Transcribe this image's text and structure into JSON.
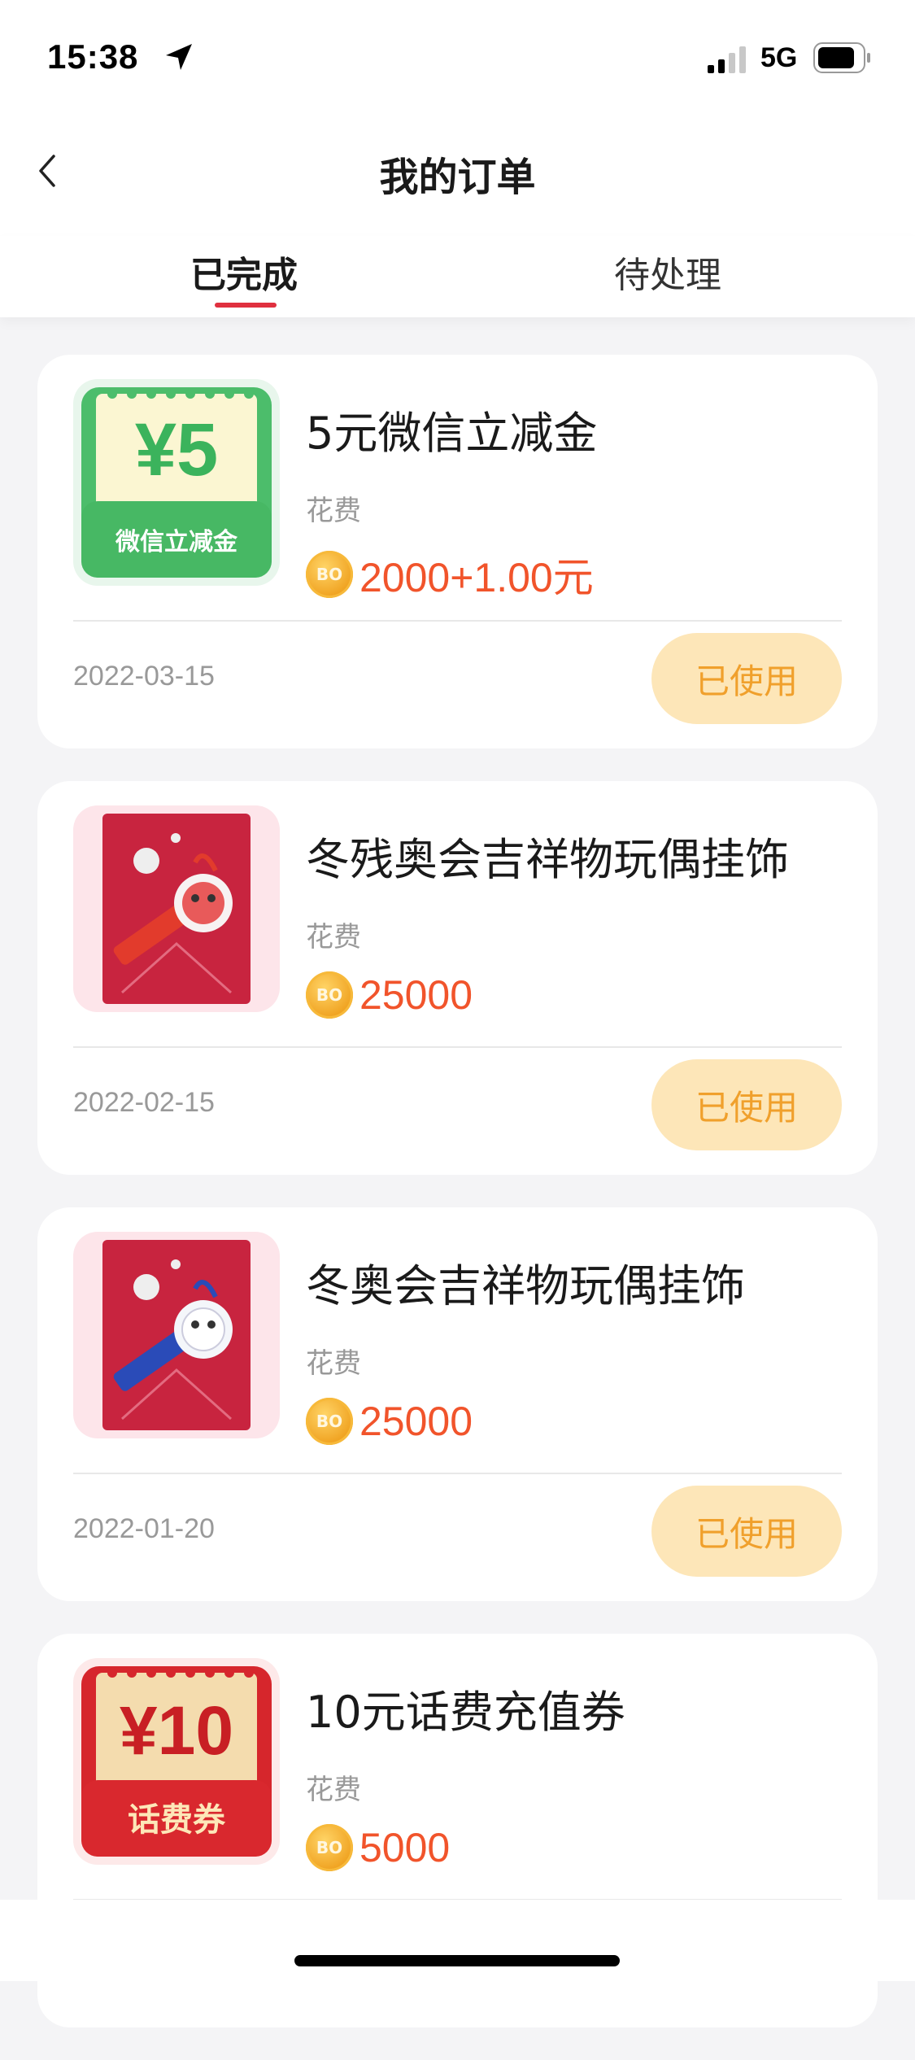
{
  "status_bar": {
    "time": "15:38",
    "network": "5G",
    "icons": [
      "location-arrow-icon",
      "signal-icon",
      "battery-icon"
    ]
  },
  "nav": {
    "title": "我的订单",
    "back_icon": "chevron-left-icon"
  },
  "tabs": [
    {
      "label": "已完成",
      "active": true
    },
    {
      "label": "待处理",
      "active": false
    }
  ],
  "orders": [
    {
      "title": "5元微信立减金",
      "cost_label": "花费",
      "coin_text": "BO",
      "price": "2000+1.00元",
      "date": "2022-03-15",
      "status": "已使用",
      "thumb": {
        "type": "voucher-green",
        "big": "¥5",
        "caption": "微信立减金"
      }
    },
    {
      "title": "冬残奥会吉祥物玩偶挂饰",
      "cost_label": "花费",
      "coin_text": "BO",
      "price": "25000",
      "date": "2022-02-15",
      "status": "已使用",
      "thumb": {
        "type": "mascot-keychain-red"
      }
    },
    {
      "title": "冬奥会吉祥物玩偶挂饰",
      "cost_label": "花费",
      "coin_text": "BO",
      "price": "25000",
      "date": "2022-01-20",
      "status": "已使用",
      "thumb": {
        "type": "mascot-keychain-blue"
      }
    },
    {
      "title": "10元话费充值券",
      "cost_label": "花费",
      "coin_text": "BO",
      "price": "5000",
      "date": "",
      "status": "",
      "thumb": {
        "type": "voucher-red",
        "big": "¥10",
        "caption": "话费券"
      }
    }
  ],
  "colors": {
    "accent": "#e0303f",
    "price": "#f1542b",
    "status_bg": "#fde6b8",
    "status_text": "#f0a02c"
  }
}
